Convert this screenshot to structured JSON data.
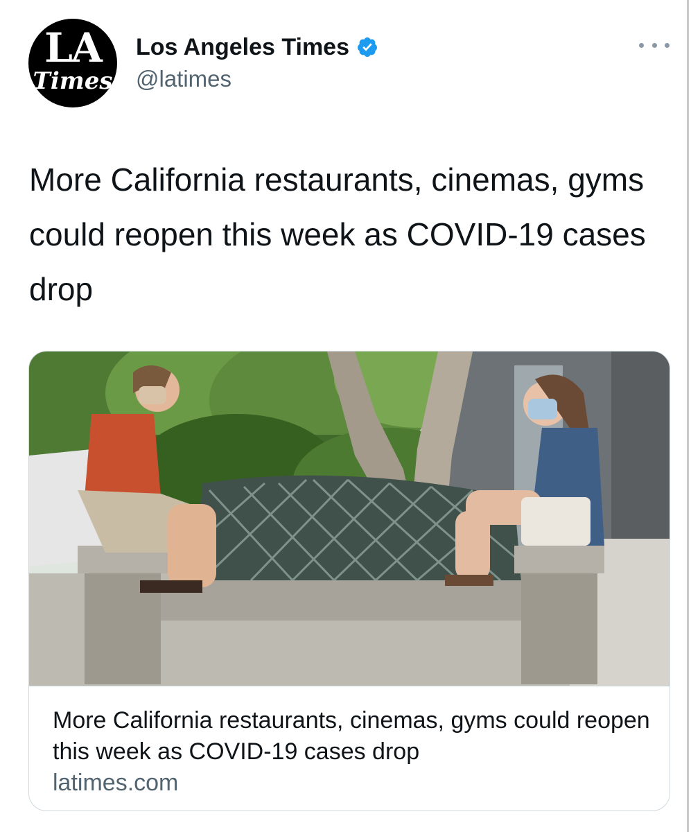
{
  "account": {
    "display_name": "Los Angeles Times",
    "handle": "@latimes",
    "avatar_text_top": "LA",
    "avatar_text_bottom": "Times",
    "verified": true
  },
  "tweet": {
    "text": "More California restaurants, cinemas, gyms could reopen this week as COVID-19 cases drop"
  },
  "link_card": {
    "title": "More California restaurants, cinemas, gyms could reopen this week as COVID-19 cases drop",
    "domain": "latimes.com",
    "image_description": "Two women wearing face masks sit at opposite ends of an outdoor bench"
  },
  "icons": {
    "verified": "verified-badge-icon",
    "more": "more-options-icon"
  },
  "colors": {
    "verified_blue": "#1d9bf0",
    "secondary_text": "#536471",
    "border": "#cfd9de"
  }
}
